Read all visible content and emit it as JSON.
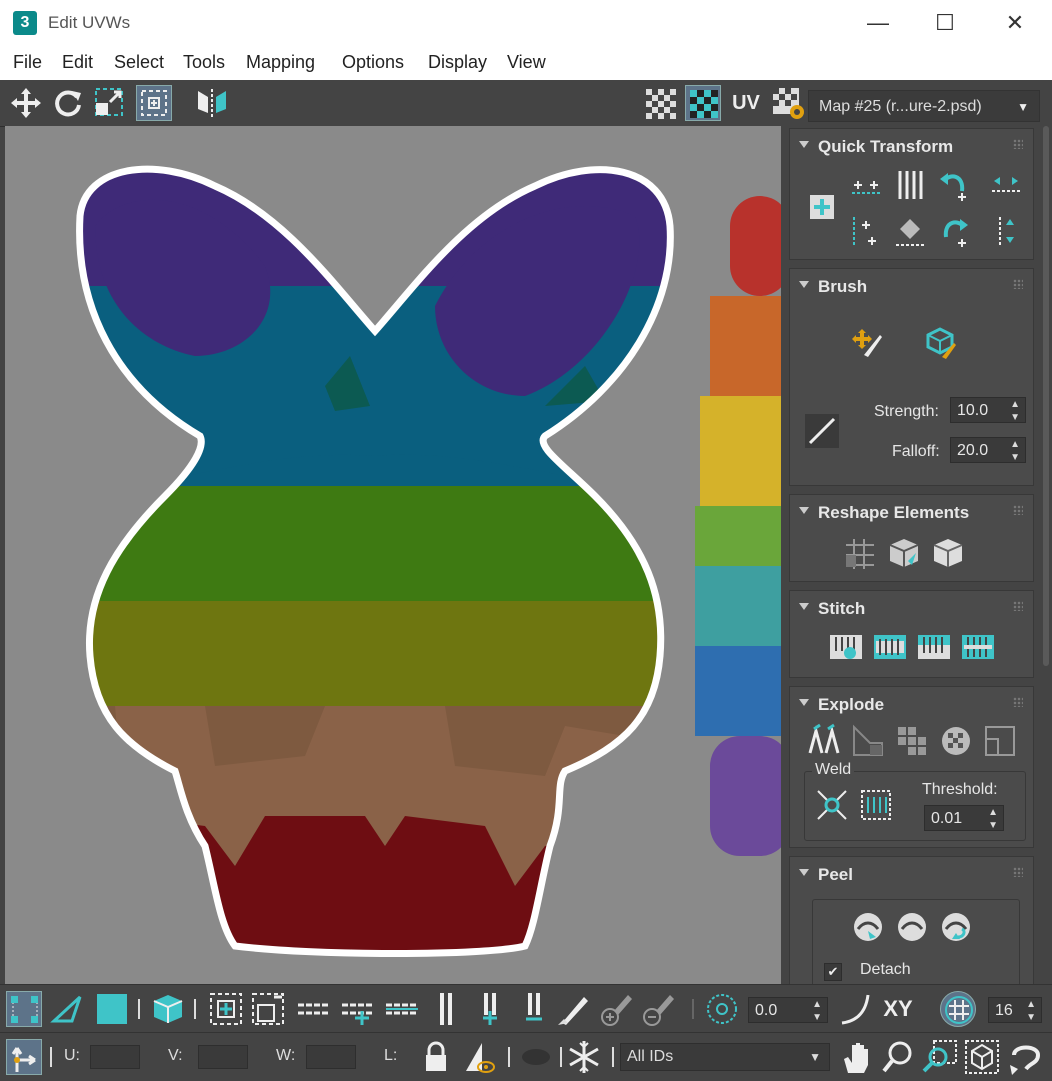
{
  "window": {
    "app_icon_text": "3",
    "title": "Edit UVWs",
    "minimize": "—",
    "maximize": "☐",
    "close": "✕"
  },
  "menu": [
    "File",
    "Edit",
    "Select",
    "Tools",
    "Mapping",
    "Options",
    "Display",
    "View"
  ],
  "toolbar": {
    "uv_label": "UV",
    "map_select": "Map #25 (r...ure-2.psd)"
  },
  "panel": {
    "quick_transform": {
      "title": "Quick Transform"
    },
    "brush": {
      "title": "Brush",
      "strength_label": "Strength:",
      "strength_value": "10.0",
      "falloff_label": "Falloff:",
      "falloff_value": "20.0"
    },
    "reshape": {
      "title": "Reshape Elements"
    },
    "stitch": {
      "title": "Stitch"
    },
    "explode": {
      "title": "Explode",
      "weld_label": "Weld",
      "threshold_label": "Threshold:",
      "threshold_value": "0.01"
    },
    "peel": {
      "title": "Peel",
      "detach_label": "Detach",
      "detach_checked": true
    }
  },
  "bottom": {
    "rotation_value": "0.0",
    "xy_label": "XY",
    "grid_value": "16",
    "u_label": "U:",
    "v_label": "V:",
    "w_label": "W:",
    "l_label": "L:",
    "ids_select": "All IDs"
  },
  "colors": {
    "accent": "#3fc4c8",
    "uv_border": "#ffffff",
    "band_purple": "#3f2a78",
    "band_blue": "#0a5f7f",
    "band_green": "#3e7a12",
    "band_olive": "#6e7610",
    "band_brown": "#7e5a40",
    "band_red": "#6e0d12"
  }
}
